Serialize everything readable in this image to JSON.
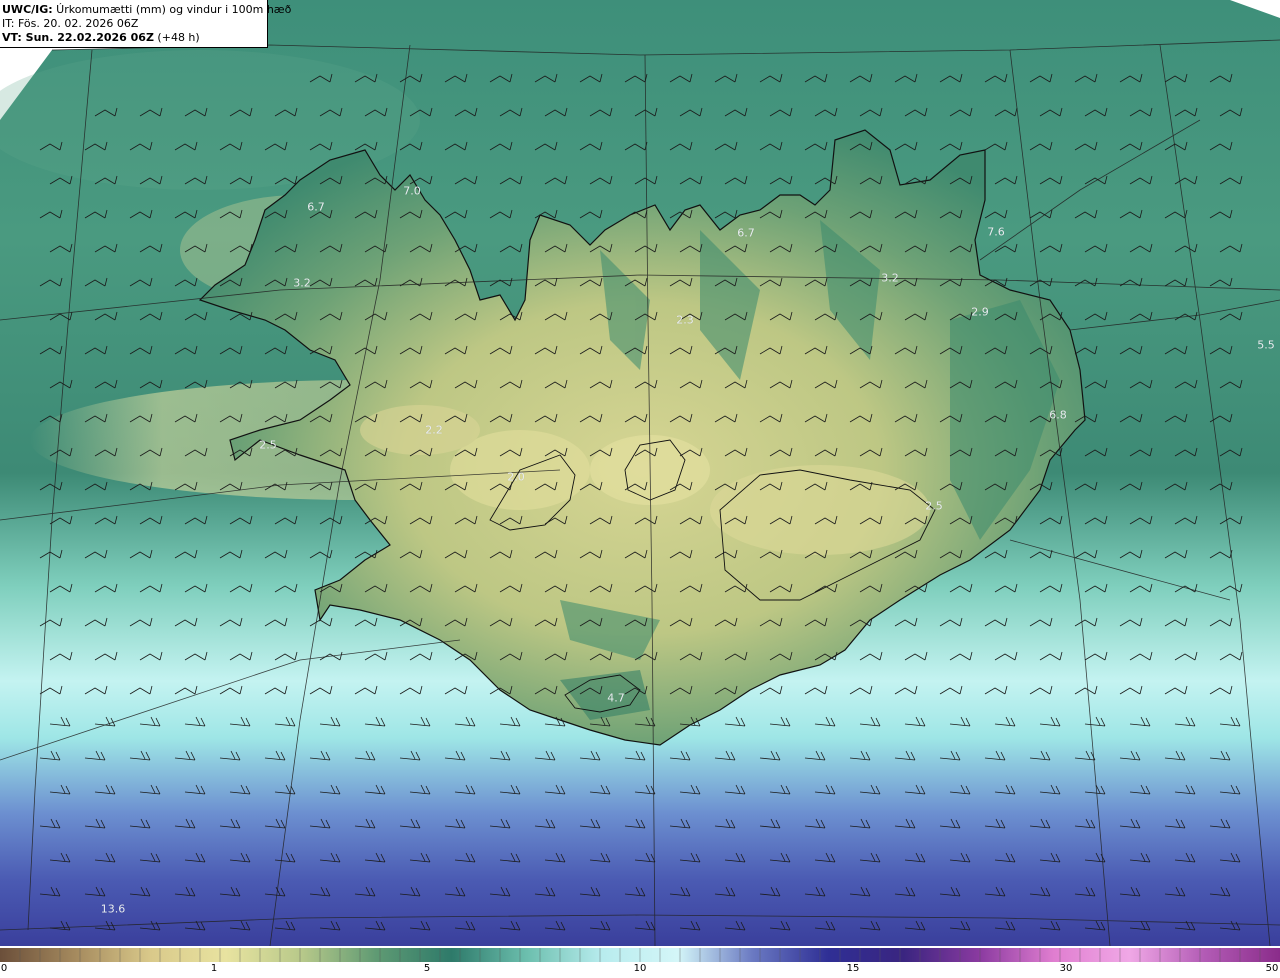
{
  "header": {
    "model": "UWC/IG:",
    "title": " Úrkomumætti (mm) og vindur i 100m hæð",
    "init_time": "IT: Fös. 20. 02. 2026 06Z",
    "valid_prefix": "VT: Sun. 22.02.2026 06Z",
    "valid_suffix": " (+48 h)"
  },
  "value_labels": [
    {
      "text": "7.0"
    },
    {
      "text": "6.7"
    },
    {
      "text": "6.7"
    },
    {
      "text": "7.6"
    },
    {
      "text": "3.2"
    },
    {
      "text": "3.2"
    },
    {
      "text": "2.9"
    },
    {
      "text": "2.3"
    },
    {
      "text": "5.5"
    },
    {
      "text": "6.8"
    },
    {
      "text": "2.2"
    },
    {
      "text": "2.5"
    },
    {
      "text": "2.0"
    },
    {
      "text": "2.5"
    },
    {
      "text": "4.7"
    },
    {
      "text": "13.6"
    }
  ],
  "colorbar": {
    "ticks": [
      "0",
      "1",
      "5",
      "10",
      "15",
      "30",
      "50"
    ],
    "stops": [
      "#6b4f3a",
      "#a58a5e",
      "#d9c98a",
      "#e8e3a0",
      "#b8c98a",
      "#5f9a73",
      "#2e7a6a",
      "#6cbfae",
      "#b8ecee",
      "#d4f6f8",
      "#6a79c2",
      "#2f2f95",
      "#3a2580",
      "#8a3aa0",
      "#e07ed0",
      "#f0a8e6",
      "#b25bb5",
      "#8a2c8a"
    ]
  },
  "colors": {
    "sea_north": "#3d8e78",
    "sea_south_light": "#bff2f2",
    "sea_far_south": "#3f4aa6",
    "land_dry": "#c9cf8a",
    "land_green": "#3b8a6c",
    "coast_line": "#111111"
  }
}
